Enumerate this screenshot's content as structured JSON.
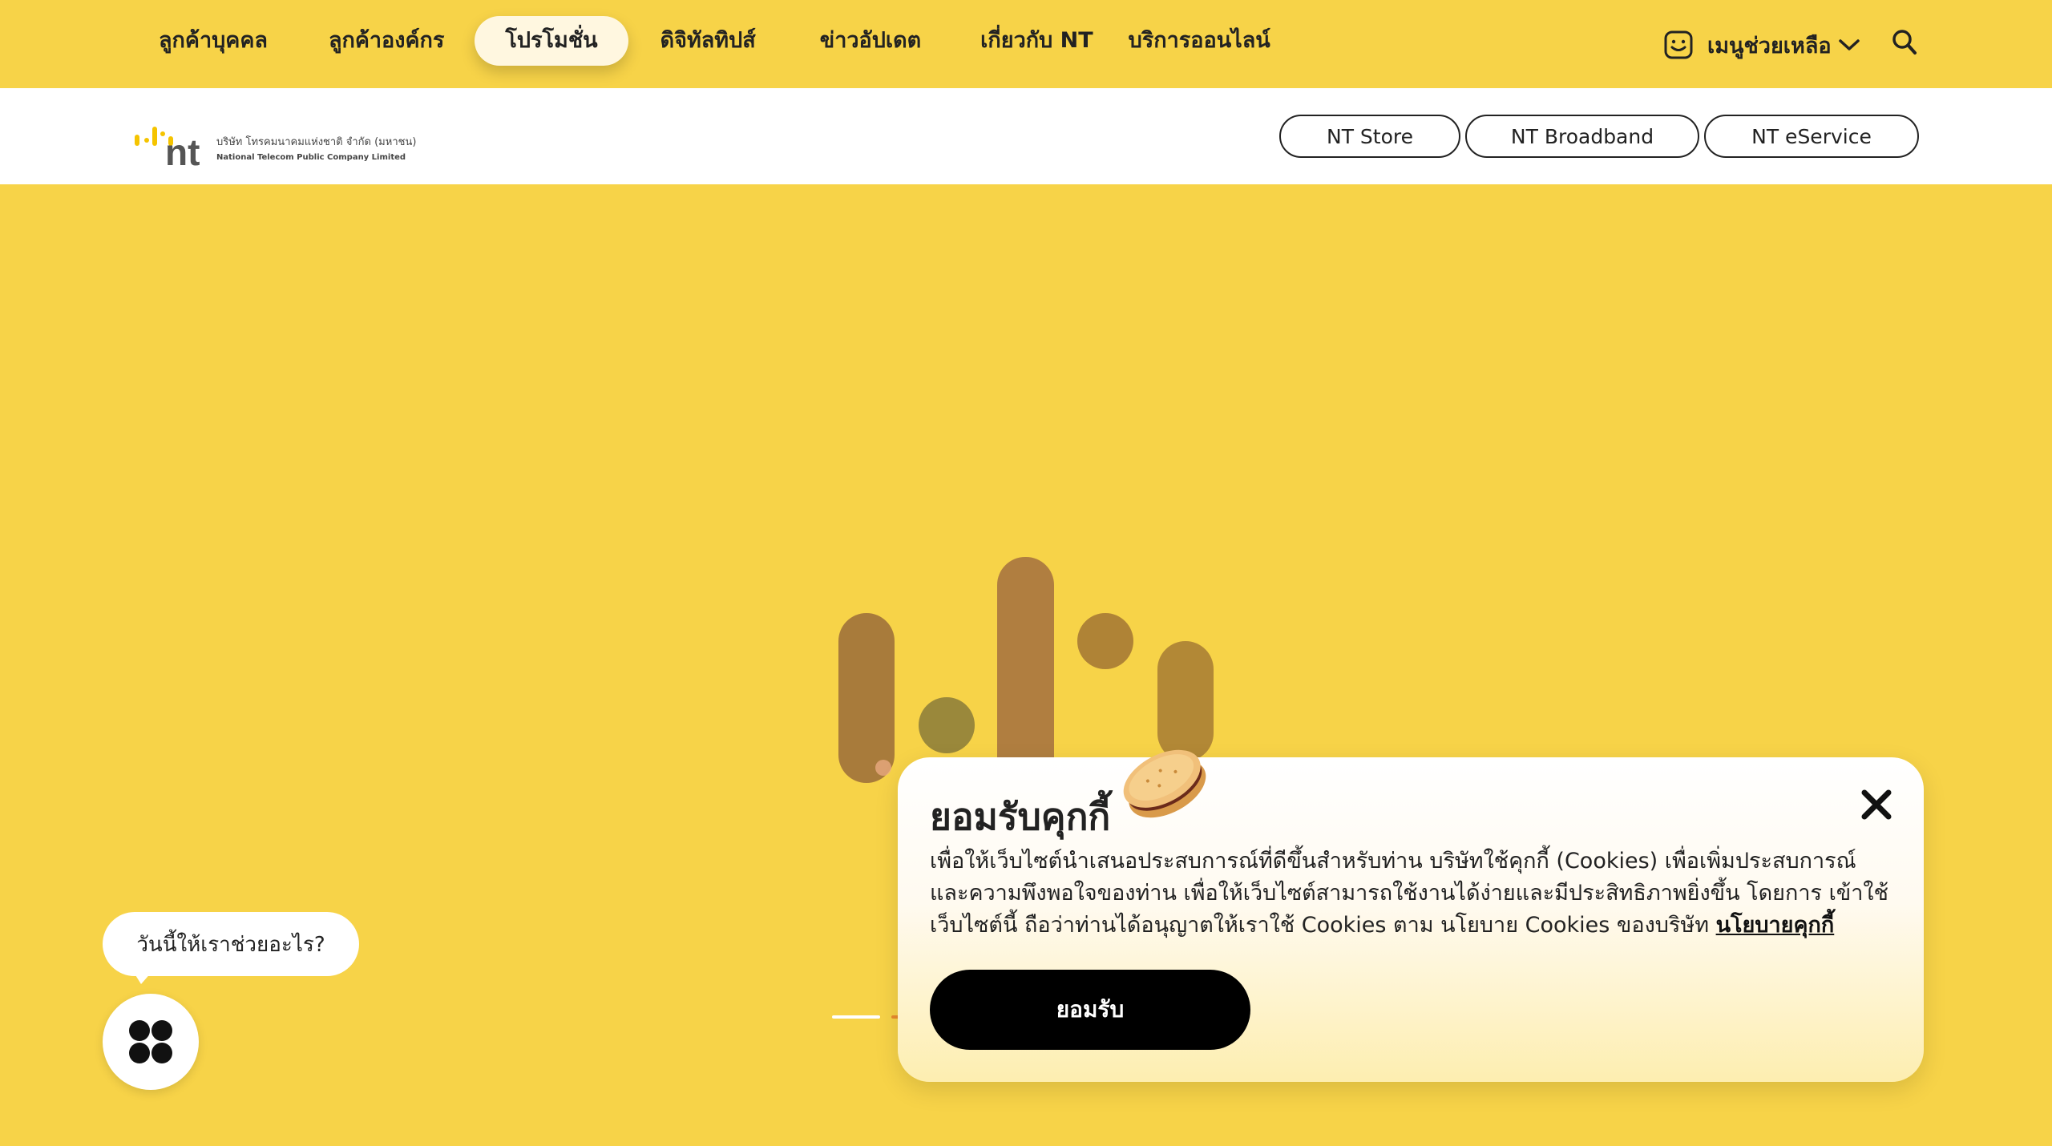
{
  "nav": {
    "items": [
      {
        "label": "ลูกค้าบุคคล"
      },
      {
        "label": "ลูกค้าองค์กร"
      },
      {
        "label": "โปรโมชั่น"
      },
      {
        "label": "ดิจิทัลทิปส์"
      },
      {
        "label": "ข่าวอัปเดต"
      },
      {
        "label": "เกี่ยวกับ NT"
      },
      {
        "label": "บริการออนไลน์"
      }
    ],
    "active_index": 2,
    "help_label": "เมนูช่วยเหลือ",
    "help_icon": "smiley-face-icon",
    "search_icon": "search-icon"
  },
  "logo": {
    "brand": "nt",
    "company_th": "บริษัท โทรคมนาคมแห่งชาติ จำกัด (มหาชน)",
    "company_en": "National Telecom Public Company Limited"
  },
  "external_links": [
    {
      "label": "NT Store"
    },
    {
      "label": "NT Broadband"
    },
    {
      "label": "NT eService"
    }
  ],
  "cookie": {
    "title": "ยอมรับคุกกี้",
    "text": "เพื่อให้เว็บไซต์นำเสนอประสบการณ์ที่ดีขึ้นสำหรับท่าน บริษัทใช้คุกกี้ (Cookies) เพื่อเพิ่มประสบการณ์ และความพึงพอใจของท่าน เพื่อให้เว็บไซต์สามารถใช้งานได้ง่ายและมีประสิทธิภาพยิ่งขึ้น โดยการ เข้าใช้เว็บไซต์นี้ ถือว่าท่านได้อนุญาตให้เราใช้ Cookies ตาม นโยบาย Cookies ของบริษัท",
    "policy_link": "นโยบายคุกกี้",
    "accept_label": "ยอมรับ",
    "close_icon": "close-icon"
  },
  "chat": {
    "bubble_text": "วันนี้ให้เราช่วยอะไร?",
    "fab_icon": "four-dots-icon"
  },
  "colors": {
    "brand_yellow": "#f7d348",
    "text_dark": "#222222",
    "accent_orange": "#e98b2d"
  }
}
